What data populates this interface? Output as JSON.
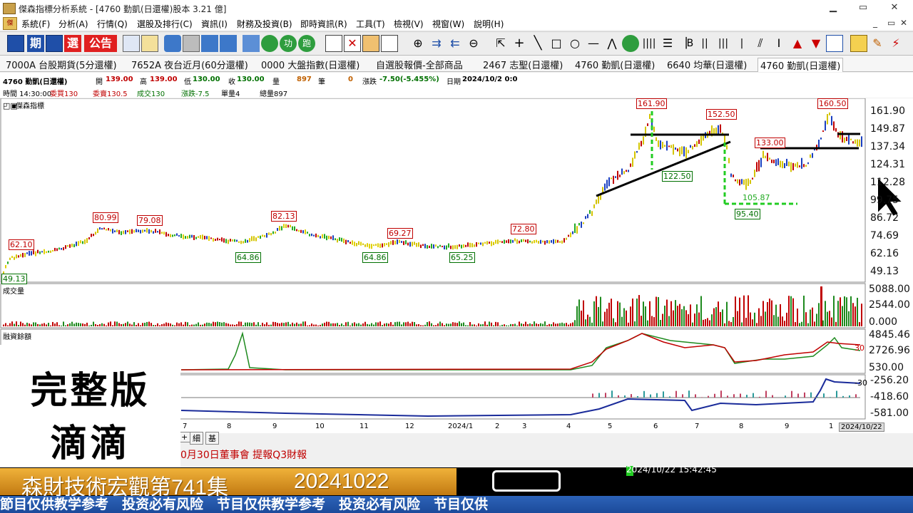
{
  "window": {
    "title": "傑森指標分析系統 - [4760 勤凱(日還權)股本 3.21 億]",
    "minimize": "▁",
    "restore": "▭",
    "close": "✕"
  },
  "menu": {
    "items": [
      "系統(F)",
      "分析(A)",
      "行情(Q)",
      "選股及排行(C)",
      "資訊(I)",
      "財務及投資(B)",
      "即時資訊(R)",
      "工具(T)",
      "檢視(V)",
      "視窗(W)",
      "說明(H)"
    ],
    "mdi_buttons": [
      "_",
      "▭",
      "✕"
    ]
  },
  "toolbar": {
    "buttons": [
      "chart-icon",
      "period-icon",
      "kline-icon",
      "select-icon",
      "announce-icon",
      "edit-icon",
      "paint-icon",
      "camera-icon",
      "print-icon",
      "split-icon",
      "window-icon",
      "trash-icon",
      "refresh-icon",
      "gong-icon",
      "pao-icon",
      "note-icon",
      "cancel-icon",
      "export-icon",
      "line-chart-icon",
      "zoom-in-icon",
      "forward-icon",
      "back-icon",
      "zoom-out-icon",
      "pointer-icon",
      "cross-icon",
      "diag-line-icon",
      "rect-icon",
      "circle-icon",
      "hline-icon",
      "fan-icon",
      "bars-icon",
      "gann-icon",
      "vlines-icon",
      "parallel-icon",
      "text-icon",
      "arrow-up-icon",
      "arrow-down-icon",
      "table-icon",
      "pencil-icon",
      "power-icon"
    ],
    "period_label": "期",
    "select_label": "選",
    "announce_label": "公告"
  },
  "tabs": [
    "7000A 台股期貨(5分還權)",
    "7652A 夜台近月(60分還權)",
    "0000 大盤指數(日還權)",
    "自選股報價-全部商品",
    "2467 志聖(日還權)",
    "4760 勤凱(日還權)",
    "6640 均華(日還權)",
    "4760 勤凱(日還權)"
  ],
  "quote": {
    "symbol": "4760 勤凱(日還權)",
    "open_label": "開",
    "open": "139.00",
    "high_label": "高",
    "high": "139.00",
    "low_label": "低",
    "low": "130.00",
    "close_label": "收",
    "close": "130.00",
    "vol_label": "量",
    "vol": "897",
    "pen_label": "筆",
    "pen": "0",
    "chg_label": "漲跌",
    "chg": "-7.50(-5.455%)",
    "date_label": "日期",
    "date": "2024/10/2 0:0",
    "time": "時間 14:30:00",
    "buy": "委買130",
    "sell": "委賣130.5",
    "deal": "成交130",
    "chg2": "漲跌-7.5",
    "unit": "單量4",
    "total": "總量897"
  },
  "charts": {
    "price_panel_title": "傑森指標",
    "volume_panel_title": "成交量",
    "margin_panel_title": "融資餘額",
    "price_axis": [
      "161.90",
      "149.87",
      "137.34",
      "124.31",
      "112.28",
      "99.75",
      "86.72",
      "74.69",
      "62.16",
      "49.13"
    ],
    "volume_axis": [
      "5088.00",
      "2544.00",
      "0.000"
    ],
    "margin_axis": [
      "4845.46",
      "2726.96",
      "530.00"
    ],
    "osc_axis": [
      "-256.20",
      "-418.60",
      "-581.00"
    ],
    "margin_side": "30",
    "osc_side": "-30",
    "x_labels": [
      "7",
      "8",
      "9",
      "10",
      "11",
      "12",
      "2024/1",
      "2",
      "3",
      "4",
      "5",
      "6",
      "7",
      "8",
      "9",
      "1",
      "2024/10/22"
    ],
    "price_labels_high": [
      "62.10",
      "80.99",
      "79.08",
      "82.13",
      "69.27",
      "72.80",
      "161.90",
      "152.50",
      "133.00",
      "160.50",
      "49.13"
    ],
    "price_labels_low": [
      "64.86",
      "64.86",
      "65.25",
      "122.50",
      "95.40",
      "105.87"
    ]
  },
  "bottom_tabs": [
    "細",
    "基"
  ],
  "news": "0月30日董事會 提報Q3財報",
  "overlay": {
    "line1": "完整版",
    "line2": "滴滴"
  },
  "banner": {
    "title": "森財技術宏觀第741集",
    "date": "20241022",
    "status_time": "2024/10/22 15:42:45"
  },
  "ticker": "節目仅供教学参考　投资必有风险　节目仅供教学参考　投资必有风险　节目仅供"
}
